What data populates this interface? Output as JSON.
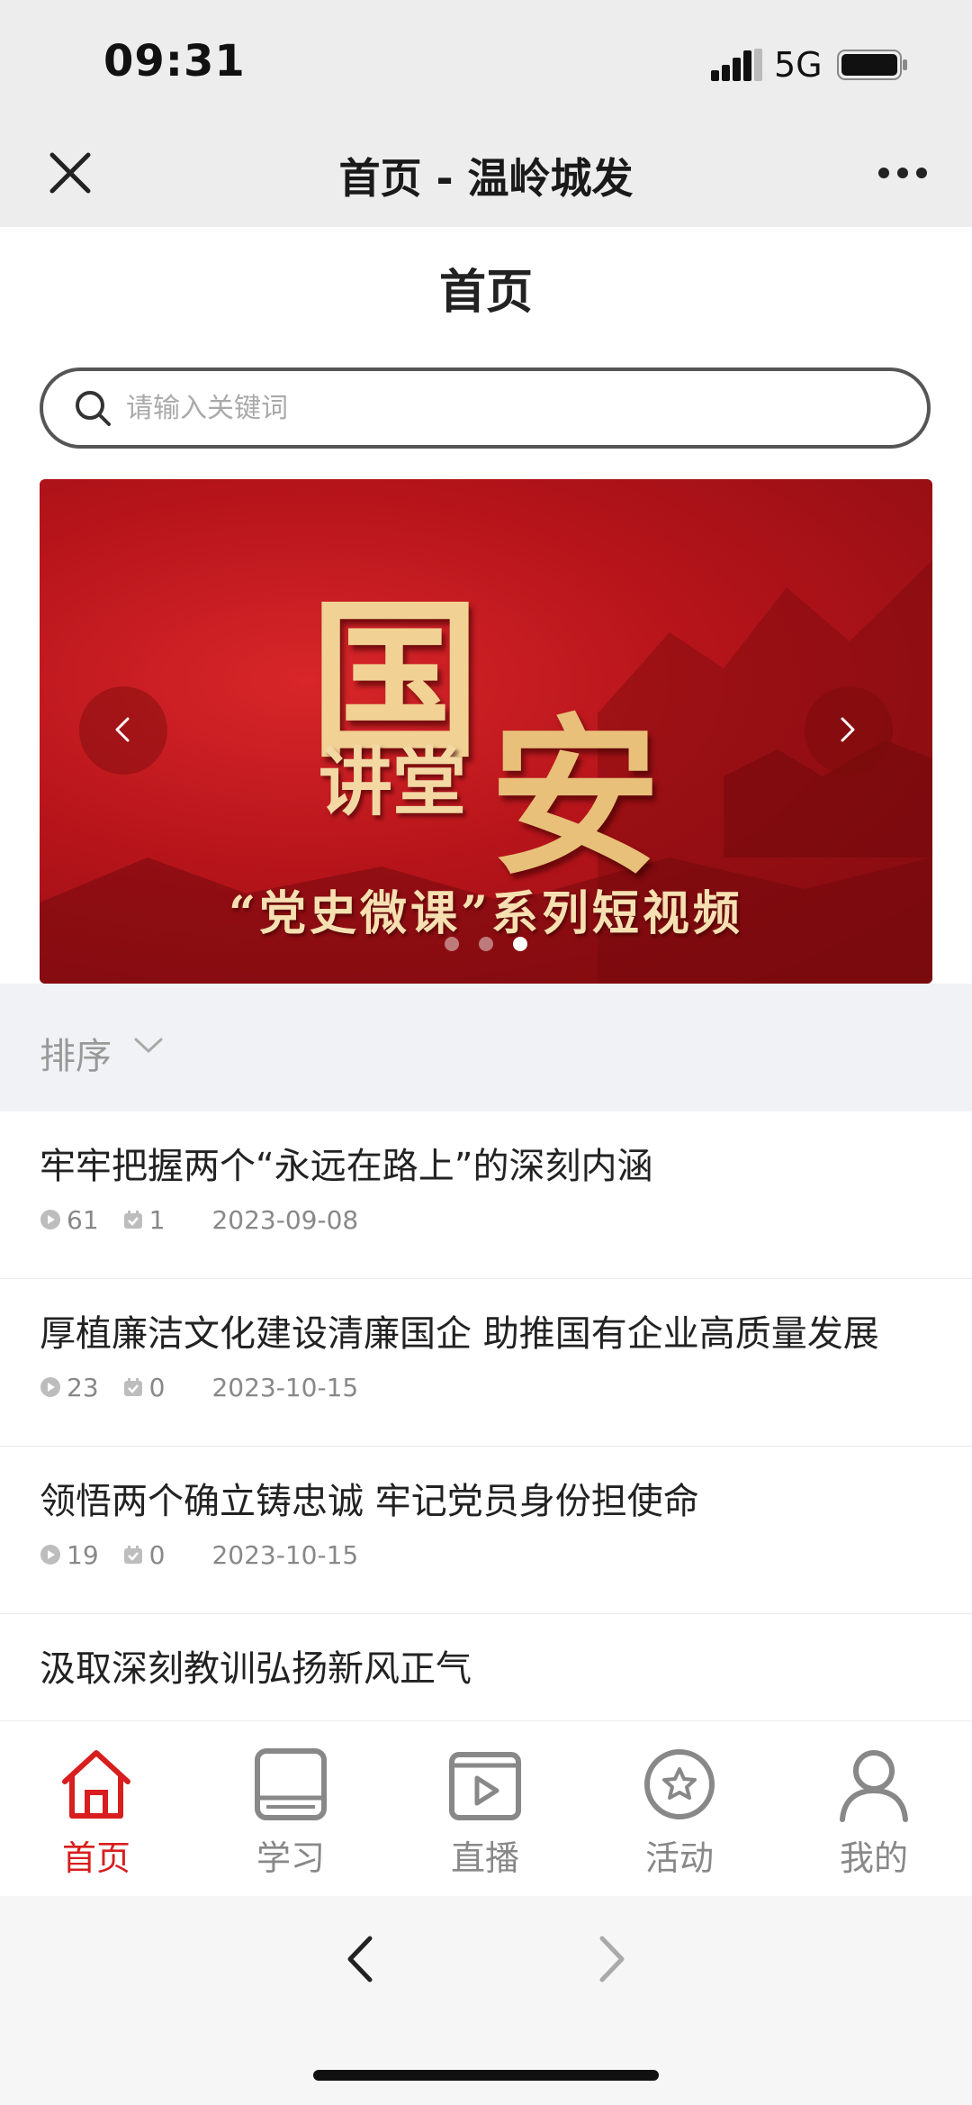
{
  "status_bar": {
    "time": "09:31",
    "network": "5G",
    "icons": [
      "signal-icon",
      "battery-icon"
    ]
  },
  "nav_bar": {
    "title": "首页 - 温岭城发",
    "icons": [
      "close-icon",
      "more-icon"
    ]
  },
  "page": {
    "title": "首页"
  },
  "search": {
    "placeholder": "请输入关键词",
    "icon": "search-icon"
  },
  "banner": {
    "title_char_1": "国",
    "title_char_2": "安",
    "subtitle": "讲堂",
    "caption": "“党史微课”系列短视频",
    "slides_total": 3,
    "active_slide": 3,
    "icons": [
      "chevron-left-icon",
      "chevron-right-icon"
    ]
  },
  "sort": {
    "label": "排序",
    "icon": "chevron-down-icon"
  },
  "list": [
    {
      "title": "牢牢把握两个“永远在路上”的深刻内涵",
      "views": "61",
      "likes": "1",
      "date": "2023-09-08"
    },
    {
      "title": "厚植廉洁文化建设清廉国企 助推国有企业高质量发展",
      "views": "23",
      "likes": "0",
      "date": "2023-10-15"
    },
    {
      "title": "领悟两个确立铸忠诚 牢记党员身份担使命",
      "views": "19",
      "likes": "0",
      "date": "2023-10-15"
    },
    {
      "title": "汲取深刻教训弘扬新风正气"
    }
  ],
  "tabs": [
    {
      "label": "首页",
      "icon": "home-icon",
      "active": true
    },
    {
      "label": "学习",
      "icon": "book-icon",
      "active": false
    },
    {
      "label": "直播",
      "icon": "live-icon",
      "active": false
    },
    {
      "label": "活动",
      "icon": "star-badge-icon",
      "active": false
    },
    {
      "label": "我的",
      "icon": "user-icon",
      "active": false
    }
  ],
  "colors": {
    "accent": "#d81e1e",
    "bar_bg": "#ededed",
    "sort_bg": "#f0f2f5"
  }
}
